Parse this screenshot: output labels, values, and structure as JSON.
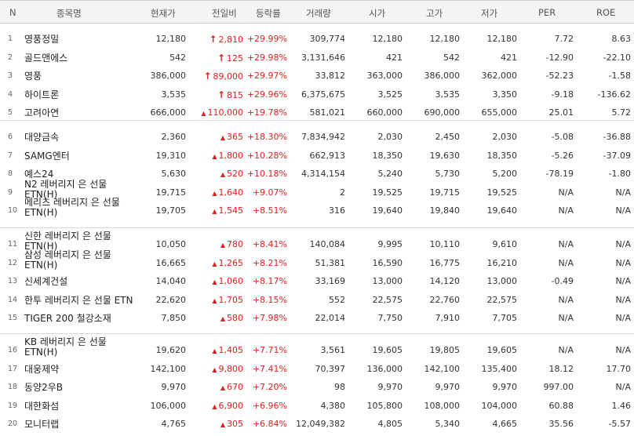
{
  "columns": {
    "n": "N",
    "name": "종목명",
    "price": "현재가",
    "change": "전일비",
    "rate": "등락률",
    "volume": "거래량",
    "open": "시가",
    "high": "고가",
    "low": "저가",
    "per": "PER",
    "roe": "ROE"
  },
  "colors": {
    "up": "#e02020",
    "header_bg": "#f4f4f4"
  },
  "groups": [
    [
      {
        "n": "1",
        "name": "영풍정밀",
        "price": "12,180",
        "arrow": "limit-up-icon",
        "change": "2,810",
        "rate": "+29.99%",
        "volume": "309,774",
        "open": "12,180",
        "high": "12,180",
        "low": "12,180",
        "per": "7.72",
        "roe": "8.63"
      },
      {
        "n": "2",
        "name": "골드앤에스",
        "price": "542",
        "arrow": "limit-up-icon",
        "change": "125",
        "rate": "+29.98%",
        "volume": "3,131,646",
        "open": "421",
        "high": "542",
        "low": "421",
        "per": "-12.90",
        "roe": "-22.10"
      },
      {
        "n": "3",
        "name": "영풍",
        "price": "386,000",
        "arrow": "limit-up-icon",
        "change": "89,000",
        "rate": "+29.97%",
        "volume": "33,812",
        "open": "363,000",
        "high": "386,000",
        "low": "362,000",
        "per": "-52.23",
        "roe": "-1.58"
      },
      {
        "n": "4",
        "name": "하이트론",
        "price": "3,535",
        "arrow": "limit-up-icon",
        "change": "815",
        "rate": "+29.96%",
        "volume": "6,375,675",
        "open": "3,525",
        "high": "3,535",
        "low": "3,350",
        "per": "-9.18",
        "roe": "-136.62"
      },
      {
        "n": "5",
        "name": "고려아연",
        "price": "666,000",
        "arrow": "up-triangle-icon",
        "change": "110,000",
        "rate": "+19.78%",
        "volume": "581,021",
        "open": "660,000",
        "high": "690,000",
        "low": "655,000",
        "per": "25.01",
        "roe": "5.72"
      }
    ],
    [
      {
        "n": "6",
        "name": "대양금속",
        "price": "2,360",
        "arrow": "up-triangle-icon",
        "change": "365",
        "rate": "+18.30%",
        "volume": "7,834,942",
        "open": "2,030",
        "high": "2,450",
        "low": "2,030",
        "per": "-5.08",
        "roe": "-36.88"
      },
      {
        "n": "7",
        "name": "SAMG엔터",
        "price": "19,310",
        "arrow": "up-triangle-icon",
        "change": "1,800",
        "rate": "+10.28%",
        "volume": "662,913",
        "open": "18,350",
        "high": "19,630",
        "low": "18,350",
        "per": "-5.26",
        "roe": "-37.09"
      },
      {
        "n": "8",
        "name": "예스24",
        "price": "5,630",
        "arrow": "up-triangle-icon",
        "change": "520",
        "rate": "+10.18%",
        "volume": "4,314,154",
        "open": "5,240",
        "high": "5,730",
        "low": "5,200",
        "per": "-78.19",
        "roe": "-1.80"
      },
      {
        "n": "9",
        "name": "N2 레버리지 은 선물 ETN(H)",
        "price": "19,715",
        "arrow": "up-triangle-icon",
        "change": "1,640",
        "rate": "+9.07%",
        "volume": "2",
        "open": "19,525",
        "high": "19,715",
        "low": "19,525",
        "per": "N/A",
        "roe": "N/A"
      },
      {
        "n": "10",
        "name": "메리츠 레버리지 은 선물 ETN(H)",
        "price": "19,705",
        "arrow": "up-triangle-icon",
        "change": "1,545",
        "rate": "+8.51%",
        "volume": "316",
        "open": "19,640",
        "high": "19,840",
        "low": "19,640",
        "per": "N/A",
        "roe": "N/A"
      }
    ],
    [
      {
        "n": "11",
        "name": "신한 레버리지 은 선물 ETN(H)",
        "price": "10,050",
        "arrow": "up-triangle-icon",
        "change": "780",
        "rate": "+8.41%",
        "volume": "140,084",
        "open": "9,995",
        "high": "10,110",
        "low": "9,610",
        "per": "N/A",
        "roe": "N/A"
      },
      {
        "n": "12",
        "name": "삼성 레버리지 은 선물 ETN(H)",
        "price": "16,665",
        "arrow": "up-triangle-icon",
        "change": "1,265",
        "rate": "+8.21%",
        "volume": "51,381",
        "open": "16,590",
        "high": "16,775",
        "low": "16,210",
        "per": "N/A",
        "roe": "N/A"
      },
      {
        "n": "13",
        "name": "신세계건설",
        "price": "14,040",
        "arrow": "up-triangle-icon",
        "change": "1,060",
        "rate": "+8.17%",
        "volume": "33,169",
        "open": "13,000",
        "high": "14,120",
        "low": "13,000",
        "per": "-0.49",
        "roe": "N/A"
      },
      {
        "n": "14",
        "name": "한투 레버리지 은 선물 ETN",
        "price": "22,620",
        "arrow": "up-triangle-icon",
        "change": "1,705",
        "rate": "+8.15%",
        "volume": "552",
        "open": "22,575",
        "high": "22,760",
        "low": "22,575",
        "per": "N/A",
        "roe": "N/A"
      },
      {
        "n": "15",
        "name": "TIGER 200 철강소재",
        "price": "7,850",
        "arrow": "up-triangle-icon",
        "change": "580",
        "rate": "+7.98%",
        "volume": "22,014",
        "open": "7,750",
        "high": "7,910",
        "low": "7,705",
        "per": "N/A",
        "roe": "N/A"
      }
    ],
    [
      {
        "n": "16",
        "name": "KB 레버리지 은 선물 ETN(H)",
        "price": "19,620",
        "arrow": "up-triangle-icon",
        "change": "1,405",
        "rate": "+7.71%",
        "volume": "3,561",
        "open": "19,605",
        "high": "19,805",
        "low": "19,605",
        "per": "N/A",
        "roe": "N/A"
      },
      {
        "n": "17",
        "name": "대웅제약",
        "price": "142,100",
        "arrow": "up-triangle-icon",
        "change": "9,800",
        "rate": "+7.41%",
        "volume": "70,397",
        "open": "136,000",
        "high": "142,100",
        "low": "135,400",
        "per": "18.12",
        "roe": "17.70"
      },
      {
        "n": "18",
        "name": "동양2우B",
        "price": "9,970",
        "arrow": "up-triangle-icon",
        "change": "670",
        "rate": "+7.20%",
        "volume": "98",
        "open": "9,970",
        "high": "9,970",
        "low": "9,970",
        "per": "997.00",
        "roe": "N/A"
      },
      {
        "n": "19",
        "name": "대한화섬",
        "price": "106,000",
        "arrow": "up-triangle-icon",
        "change": "6,900",
        "rate": "+6.96%",
        "volume": "4,380",
        "open": "105,800",
        "high": "108,000",
        "low": "104,000",
        "per": "60.88",
        "roe": "1.46"
      },
      {
        "n": "20",
        "name": "모니터랩",
        "price": "4,765",
        "arrow": "up-triangle-icon",
        "change": "305",
        "rate": "+6.84%",
        "volume": "12,049,382",
        "open": "4,805",
        "high": "5,340",
        "low": "4,665",
        "per": "35.56",
        "roe": "-5.57"
      }
    ]
  ]
}
